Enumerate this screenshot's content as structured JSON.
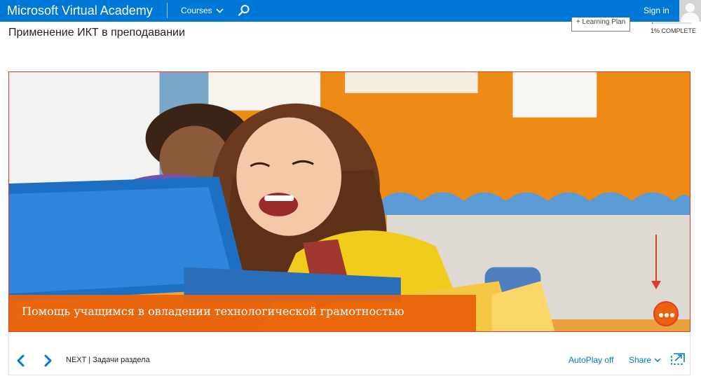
{
  "header": {
    "brand": "Microsoft Virtual Academy",
    "courses_label": "Courses",
    "signin_label": "Sign in"
  },
  "course": {
    "title": "Применение ИКТ в преподавании",
    "learning_plan_label": "+ Learning Plan",
    "progress_percent": 1,
    "progress_label": "1% COMPLETE"
  },
  "video": {
    "caption": "Помощь учащимся в овладении технологической грамотностью"
  },
  "controls": {
    "next_label": "NEXT | Задачи раздела",
    "autoplay_label": "AutoPlay off",
    "share_label": "Share"
  },
  "colors": {
    "brand_blue": "#0078d7",
    "caption_orange": "#ea630c",
    "annotation_red": "#e53a2b"
  }
}
